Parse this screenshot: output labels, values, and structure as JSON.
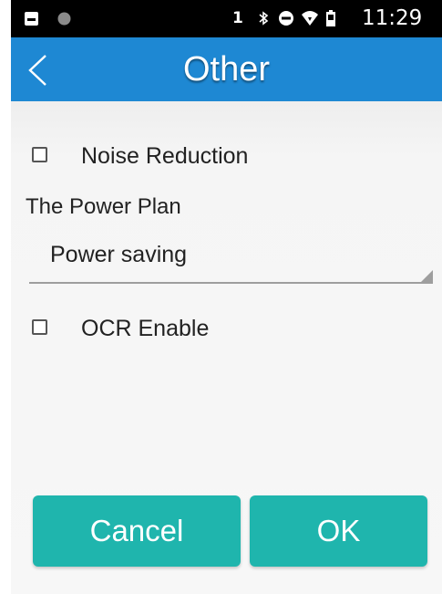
{
  "status_bar": {
    "sim_indicator": "1",
    "time": "11:29",
    "icons": [
      "image-icon",
      "dot-icon",
      "bluetooth-icon",
      "do-not-disturb-icon",
      "wifi-icon",
      "battery-icon"
    ]
  },
  "title_bar": {
    "title": "Other",
    "back_icon": "chevron-left-icon",
    "color": "#1e88d3"
  },
  "settings": {
    "noise_reduction": {
      "label": "Noise Reduction",
      "checked": false
    },
    "power_plan": {
      "label": "The Power Plan",
      "selected": "Power saving"
    },
    "ocr_enable": {
      "label": "OCR Enable",
      "checked": false
    }
  },
  "buttons": {
    "cancel": "Cancel",
    "ok": "OK",
    "color": "#1fb5ad"
  }
}
